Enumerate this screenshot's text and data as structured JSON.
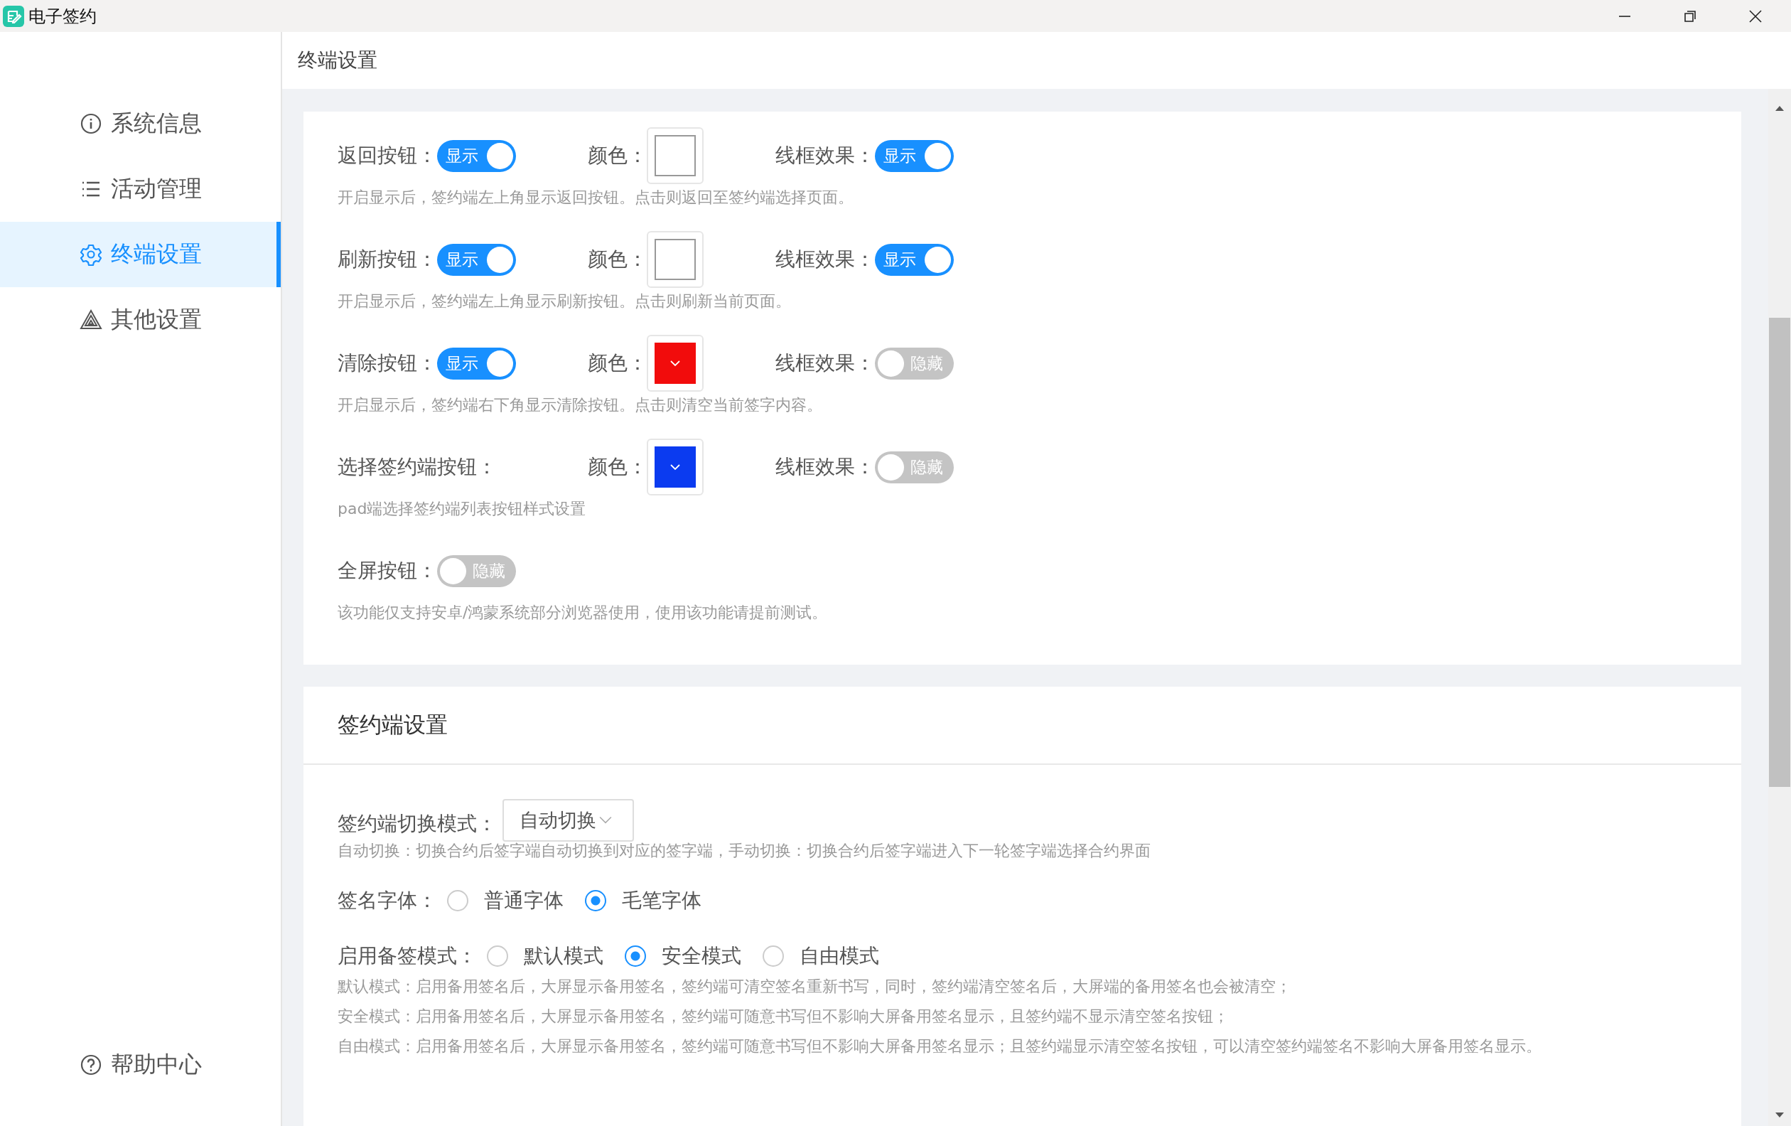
{
  "window": {
    "title": "电子签约"
  },
  "sidebar": {
    "items": [
      {
        "label": "系统信息",
        "selected": false
      },
      {
        "label": "活动管理",
        "selected": false
      },
      {
        "label": "终端设置",
        "selected": true
      },
      {
        "label": "其他设置",
        "selected": false
      }
    ],
    "help": "帮助中心"
  },
  "header": {
    "title": "终端设置"
  },
  "terminal_settings": {
    "rows": [
      {
        "label": "返回按钮：",
        "toggle": {
          "on": true,
          "text": "显示"
        },
        "color_label": "颜色：",
        "border_label": "线框效果：",
        "border": {
          "on": true,
          "text": "显示"
        },
        "hint": "开启显示后，签约端左上角显示返回按钮。点击则返回至签约端选择页面。"
      },
      {
        "label": "刷新按钮：",
        "toggle": {
          "on": true,
          "text": "显示"
        },
        "color_label": "颜色：",
        "border_label": "线框效果：",
        "border": {
          "on": true,
          "text": "显示"
        },
        "hint": "开启显示后，签约端左上角显示刷新按钮。点击则刷新当前页面。"
      },
      {
        "label": "清除按钮：",
        "toggle": {
          "on": true,
          "text": "显示"
        },
        "color_label": "颜色：",
        "color": "#f20c0c",
        "border_label": "线框效果：",
        "border": {
          "on": false,
          "text": "隐藏"
        },
        "hint": "开启显示后，签约端右下角显示清除按钮。点击则清空当前签字内容。"
      },
      {
        "label": "选择签约端按钮：",
        "color_label": "颜色：",
        "color": "#0b3bf0",
        "border_label": "线框效果：",
        "border": {
          "on": false,
          "text": "隐藏"
        },
        "hint": "pad端选择签约端列表按钮样式设置"
      },
      {
        "label": "全屏按钮：",
        "toggle": {
          "on": false,
          "text": "隐藏"
        },
        "hint": "该功能仅支持安卓/鸿蒙系统部分浏览器使用，使用该功能请提前测试。"
      }
    ]
  },
  "client_settings": {
    "title": "签约端设置",
    "switch_mode": {
      "label": "签约端切换模式：",
      "value": "自动切换",
      "hint": "自动切换：切换合约后签字端自动切换到对应的签字端，手动切换：切换合约后签字端进入下一轮签字端选择合约界面"
    },
    "font": {
      "label": "签名字体：",
      "options": [
        {
          "label": "普通字体",
          "selected": false
        },
        {
          "label": "毛笔字体",
          "selected": true
        }
      ]
    },
    "backup": {
      "label": "启用备签模式：",
      "options": [
        {
          "label": "默认模式",
          "selected": false
        },
        {
          "label": "安全模式",
          "selected": true
        },
        {
          "label": "自由模式",
          "selected": false
        }
      ],
      "hints": [
        "默认模式：启用备用签名后，大屏显示备用签名，签约端可清空签名重新书写，同时，签约端清空签名后，大屏端的备用签名也会被清空；",
        "安全模式：启用备用签名后，大屏显示备用签名，签约端可随意书写但不影响大屏备用签名显示，且签约端不显示清空签名按钮；",
        "自由模式：启用备用签名后，大屏显示备用签名，签约端可随意书写但不影响大屏备用签名显示；且签约端显示清空签名按钮，可以清空签约端签名不影响大屏备用签名显示。"
      ]
    }
  }
}
